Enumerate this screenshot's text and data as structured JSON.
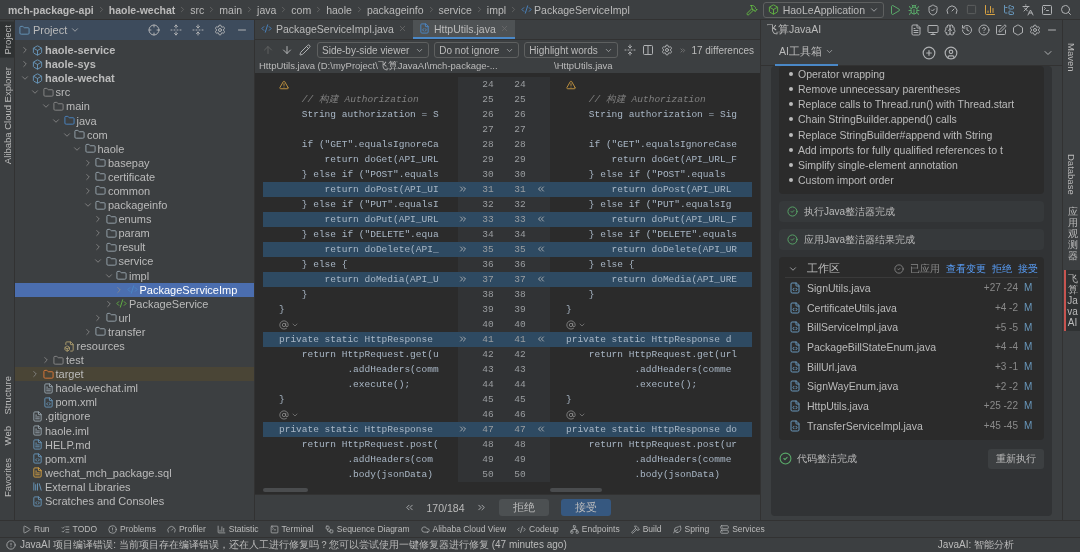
{
  "breadcrumb": [
    {
      "label": "mch-package-api",
      "bold": true
    },
    {
      "label": "haole-wechat",
      "bold": true
    },
    {
      "label": "src",
      "bold": false
    },
    {
      "label": "main",
      "bold": false
    },
    {
      "label": "java",
      "bold": false
    },
    {
      "label": "com",
      "bold": false
    },
    {
      "label": "haole",
      "bold": false
    },
    {
      "label": "packageinfo",
      "bold": false
    },
    {
      "label": "service",
      "bold": false
    },
    {
      "label": "impl",
      "bold": false
    },
    {
      "label": "PackageServiceImpl",
      "bold": false,
      "kind": "class"
    }
  ],
  "run_config": "HaoLeApplication",
  "left_strip": [
    {
      "label": "Project",
      "selected": true
    },
    {
      "label": "Alibaba Cloud Explorer",
      "selected": false
    },
    {
      "label": "Structure",
      "selected": false
    },
    {
      "label": "Web",
      "selected": false
    },
    {
      "label": "Favorites",
      "selected": false
    }
  ],
  "project_panel": {
    "title": "Project",
    "tree": [
      {
        "children": [
          {
            "label": "haole-service",
            "kind": "module",
            "expanded": false,
            "selected": false
          },
          {
            "label": "haole-sys",
            "kind": "module",
            "expanded": false,
            "selected": false
          },
          {
            "label": "haole-wechat",
            "kind": "module",
            "expanded": true,
            "selected": false,
            "children": [
              {
                "label": "src",
                "kind": "folder",
                "expanded": true,
                "selected": false,
                "children": [
                  {
                    "label": "main",
                    "kind": "folder",
                    "expanded": true,
                    "selected": false,
                    "children": [
                      {
                        "label": "java",
                        "kind": "source",
                        "expanded": true,
                        "selected": false,
                        "children": [
                          {
                            "label": "com",
                            "kind": "package",
                            "expanded": true,
                            "selected": false,
                            "children": [
                              {
                                "label": "haole",
                                "kind": "package",
                                "expanded": true,
                                "selected": false,
                                "children": [
                                  {
                                    "label": "basepay",
                                    "kind": "package",
                                    "expanded": false,
                                    "selected": false
                                  },
                                  {
                                    "label": "certificate",
                                    "kind": "package",
                                    "expanded": false,
                                    "selected": false
                                  },
                                  {
                                    "label": "common",
                                    "kind": "package",
                                    "expanded": false,
                                    "selected": false
                                  },
                                  {
                                    "label": "packageinfo",
                                    "kind": "package",
                                    "expanded": true,
                                    "selected": false,
                                    "children": [
                                      {
                                        "label": "enums",
                                        "kind": "package",
                                        "expanded": false,
                                        "selected": false
                                      },
                                      {
                                        "label": "param",
                                        "kind": "package",
                                        "expanded": false,
                                        "selected": false
                                      },
                                      {
                                        "label": "result",
                                        "kind": "package",
                                        "expanded": false,
                                        "selected": false
                                      },
                                      {
                                        "label": "service",
                                        "kind": "package",
                                        "expanded": true,
                                        "selected": false,
                                        "children": [
                                          {
                                            "label": "impl",
                                            "kind": "package",
                                            "expanded": true,
                                            "selected": false,
                                            "children": [
                                              {
                                                "label": "PackageServiceImp",
                                                "kind": "class",
                                                "expanded": false,
                                                "selected": true
                                              }
                                            ]
                                          },
                                          {
                                            "label": "PackageService",
                                            "kind": "interface",
                                            "expanded": false,
                                            "selected": false
                                          }
                                        ]
                                      },
                                      {
                                        "label": "url",
                                        "kind": "package",
                                        "expanded": false,
                                        "selected": false
                                      }
                                    ]
                                  },
                                  {
                                    "label": "transfer",
                                    "kind": "package",
                                    "expanded": false,
                                    "selected": false
                                  }
                                ]
                              }
                            ]
                          }
                        ]
                      },
                      {
                        "label": "resources",
                        "kind": "resources",
                        "selected": false
                      }
                    ]
                  },
                  {
                    "label": "test",
                    "kind": "folder",
                    "expanded": false,
                    "selected": false
                  }
                ]
              },
              {
                "label": "target",
                "kind": "excluded",
                "expanded": false,
                "selected": false
              },
              {
                "label": "haole-wechat.iml",
                "kind": "iml",
                "selected": false
              },
              {
                "label": "pom.xml",
                "kind": "maven",
                "selected": false
              }
            ]
          },
          {
            "label": ".gitignore",
            "kind": "gitignore",
            "selected": false
          },
          {
            "label": "haole.iml",
            "kind": "iml",
            "selected": false
          },
          {
            "label": "HELP.md",
            "kind": "markdown",
            "selected": false
          },
          {
            "label": "pom.xml",
            "kind": "maven",
            "selected": false
          },
          {
            "label": "wechat_mch_package.sql",
            "kind": "sql",
            "selected": false
          }
        ]
      },
      {
        "label": "External Libraries",
        "kind": "libraries",
        "selected": false
      },
      {
        "label": "Scratches and Consoles",
        "kind": "scratches",
        "selected": false
      }
    ]
  },
  "editor": {
    "tabs": [
      {
        "label": "PackageServiceImpl.java",
        "kind": "class",
        "selected": false
      },
      {
        "label": "HttpUtils.java",
        "kind": "util",
        "selected": true
      }
    ],
    "viewer_mode": "Side-by-side viewer",
    "ignore_mode": "Do not ignore",
    "highlight_mode": "Highlight words",
    "differences": "17 differences",
    "left_path": "HttpUtils.java (D:\\myProject\\飞算JavaAI\\mch-package-...",
    "right_path": "\\HttpUtils.java",
    "rows": [
      {
        "left_no": "24",
        "right_no": "24",
        "kind": "blank",
        "changed": false,
        "left_code": "",
        "right_code": ""
      },
      {
        "left_no": "25",
        "right_no": "25",
        "kind": "comment",
        "changed": false,
        "left_code": "    // 构建 Authorization",
        "right_code": "    // 构建 Authorization"
      },
      {
        "left_no": "26",
        "right_no": "26",
        "kind": "code",
        "changed": false,
        "left_code": "    String authorization = S",
        "right_code": "    String authorization = Sig"
      },
      {
        "left_no": "27",
        "right_no": "27",
        "kind": "blank",
        "changed": false,
        "left_code": "",
        "right_code": ""
      },
      {
        "left_no": "28",
        "right_no": "28",
        "kind": "code",
        "changed": false,
        "left_code": "    if (\"GET\".equalsIgnoreCa",
        "right_code": "    if (\"GET\".equalsIgnoreCase"
      },
      {
        "left_no": "29",
        "right_no": "29",
        "kind": "code",
        "changed": false,
        "left_code": "        return doGet(API_URL",
        "right_code": "        return doGet(API_URL_F"
      },
      {
        "left_no": "30",
        "right_no": "30",
        "kind": "code",
        "changed": false,
        "left_code": "    } else if (\"POST\".equals",
        "right_code": "    } else if (\"POST\".equals"
      },
      {
        "left_no": "31",
        "right_no": "31",
        "kind": "code",
        "changed": true,
        "left_code": "        return doPost(API_UI",
        "right_code": "        return doPost(API_URL"
      },
      {
        "left_no": "32",
        "right_no": "32",
        "kind": "code",
        "changed": false,
        "left_code": "    } else if (\"PUT\".equalsI",
        "right_code": "    } else if (\"PUT\".equalsIg"
      },
      {
        "left_no": "33",
        "right_no": "33",
        "kind": "code",
        "changed": true,
        "left_code": "        return doPut(API_URL",
        "right_code": "        return doPut(API_URL_F"
      },
      {
        "left_no": "34",
        "right_no": "34",
        "kind": "code",
        "changed": false,
        "left_code": "    } else if (\"DELETE\".equa",
        "right_code": "    } else if (\"DELETE\".equals"
      },
      {
        "left_no": "35",
        "right_no": "35",
        "kind": "code",
        "changed": true,
        "left_code": "        return doDelete(API_",
        "right_code": "        return doDelete(API_UR"
      },
      {
        "left_no": "36",
        "right_no": "36",
        "kind": "code",
        "changed": false,
        "left_code": "    } else {",
        "right_code": "    } else {"
      },
      {
        "left_no": "37",
        "right_no": "37",
        "kind": "code",
        "changed": true,
        "left_code": "        return doMedia(API_U",
        "right_code": "        return doMedia(API_URE"
      },
      {
        "left_no": "38",
        "right_no": "38",
        "kind": "code",
        "changed": false,
        "left_code": "    }",
        "right_code": "    }"
      },
      {
        "left_no": "39",
        "right_no": "39",
        "kind": "code",
        "changed": false,
        "left_code": "}",
        "right_code": "}"
      },
      {
        "left_no": "40",
        "right_no": "40",
        "kind": "annotation",
        "changed": false,
        "left_code": "",
        "right_code": ""
      },
      {
        "left_no": "41",
        "right_no": "41",
        "kind": "code",
        "changed": true,
        "left_code": "private static HttpResponse",
        "right_code": "private static HttpResponse d"
      },
      {
        "left_no": "42",
        "right_no": "42",
        "kind": "code",
        "changed": false,
        "left_code": "    return HttpRequest.get(u",
        "right_code": "    return HttpRequest.get(url"
      },
      {
        "left_no": "43",
        "right_no": "43",
        "kind": "code",
        "changed": false,
        "left_code": "            .addHeaders(comm",
        "right_code": "            .addHeaders(comme"
      },
      {
        "left_no": "44",
        "right_no": "44",
        "kind": "code",
        "changed": false,
        "left_code": "            .execute();",
        "right_code": "            .execute();"
      },
      {
        "left_no": "45",
        "right_no": "45",
        "kind": "code",
        "changed": false,
        "left_code": "}",
        "right_code": "}"
      },
      {
        "left_no": "46",
        "right_no": "46",
        "kind": "annotation",
        "changed": false,
        "left_code": "",
        "right_code": ""
      },
      {
        "left_no": "47",
        "right_no": "47",
        "kind": "code",
        "changed": true,
        "left_code": "private static HttpResponse",
        "right_code": "private static HttpResponse do"
      },
      {
        "left_no": "48",
        "right_no": "48",
        "kind": "code",
        "changed": false,
        "left_code": "    return HttpRequest.post(",
        "right_code": "    return HttpRequest.post(ur"
      },
      {
        "left_no": "49",
        "right_no": "49",
        "kind": "code",
        "changed": false,
        "left_code": "            .addHeaders(com",
        "right_code": "            .addHeaders(comme"
      },
      {
        "left_no": "50",
        "right_no": "50",
        "kind": "code",
        "changed": false,
        "left_code": "            .body(jsonData)",
        "right_code": "            .body(jsonData)"
      }
    ],
    "position": "170/184",
    "reject": "拒绝",
    "accept": "接受"
  },
  "ai_panel": {
    "title": "飞算JavaAI",
    "tabs": [
      {
        "label": "AI工具箱",
        "selected": true
      }
    ],
    "rules": [
      "Operator wrapping",
      "Remove unnecessary parentheses",
      "Replace calls to Thread.run() with Thread.start",
      "Chain StringBuilder.append() calls",
      "Replace StringBuilder#append with String",
      "Add imports for fully qualified references to t",
      "Simplify single-element annotation",
      "Custom import order"
    ],
    "steps": [
      "执行Java整洁器完成",
      "应用Java整洁器结果完成"
    ],
    "workspace": {
      "title": "工作区",
      "expanded": true,
      "applied": "已应用",
      "actions": [
        "查看变更",
        "拒绝",
        "接受"
      ],
      "files": [
        {
          "name": "SignUtils.java",
          "changes": "+27 -24",
          "status": "M"
        },
        {
          "name": "CertificateUtils.java",
          "changes": "+4 -2",
          "status": "M"
        },
        {
          "name": "BillServiceImpl.java",
          "changes": "+5 -5",
          "status": "M"
        },
        {
          "name": "PackageBillStateEnum.java",
          "changes": "+4 -4",
          "status": "M"
        },
        {
          "name": "BillUrl.java",
          "changes": "+3 -1",
          "status": "M"
        },
        {
          "name": "SignWayEnum.java",
          "changes": "+2 -2",
          "status": "M"
        },
        {
          "name": "HttpUtils.java",
          "changes": "+25 -22",
          "status": "M"
        },
        {
          "name": "TransferServiceImpl.java",
          "changes": "+45 -45",
          "status": "M"
        }
      ]
    },
    "done": "代码整洁完成",
    "rerun": "重新执行"
  },
  "right_strip": [
    {
      "label": "Maven",
      "kind": "latin",
      "selected": false
    },
    {
      "label": "Database",
      "kind": "latin",
      "selected": false
    },
    {
      "label": "应用观测器",
      "kind": "cjk",
      "selected": false
    },
    {
      "label": "飞算JavaAI",
      "kind": "cjk",
      "selected": true
    }
  ],
  "tool_windows": [
    {
      "label": "Run",
      "kind": "run"
    },
    {
      "label": "TODO",
      "kind": "todo"
    },
    {
      "label": "Problems",
      "kind": "problems"
    },
    {
      "label": "Profiler",
      "kind": "profiler"
    },
    {
      "label": "Statistic",
      "kind": "statistic"
    },
    {
      "label": "Terminal",
      "kind": "terminal"
    },
    {
      "label": "Sequence Diagram",
      "kind": "sequence"
    },
    {
      "label": "Alibaba Cloud View",
      "kind": "cloud"
    },
    {
      "label": "Codeup",
      "kind": "codeup"
    },
    {
      "label": "Endpoints",
      "kind": "endpoints"
    },
    {
      "label": "Build",
      "kind": "build"
    },
    {
      "label": "Spring",
      "kind": "spring"
    },
    {
      "label": "Services",
      "kind": "services"
    }
  ],
  "status_bar": {
    "message": "JavaAI 项目编译错误: 当前项目存在编译错误，还在人工进行修复吗？您可以尝试使用一键修复器进行修复 (47 minutes ago)",
    "right": "JavaAI: 智能分析"
  }
}
